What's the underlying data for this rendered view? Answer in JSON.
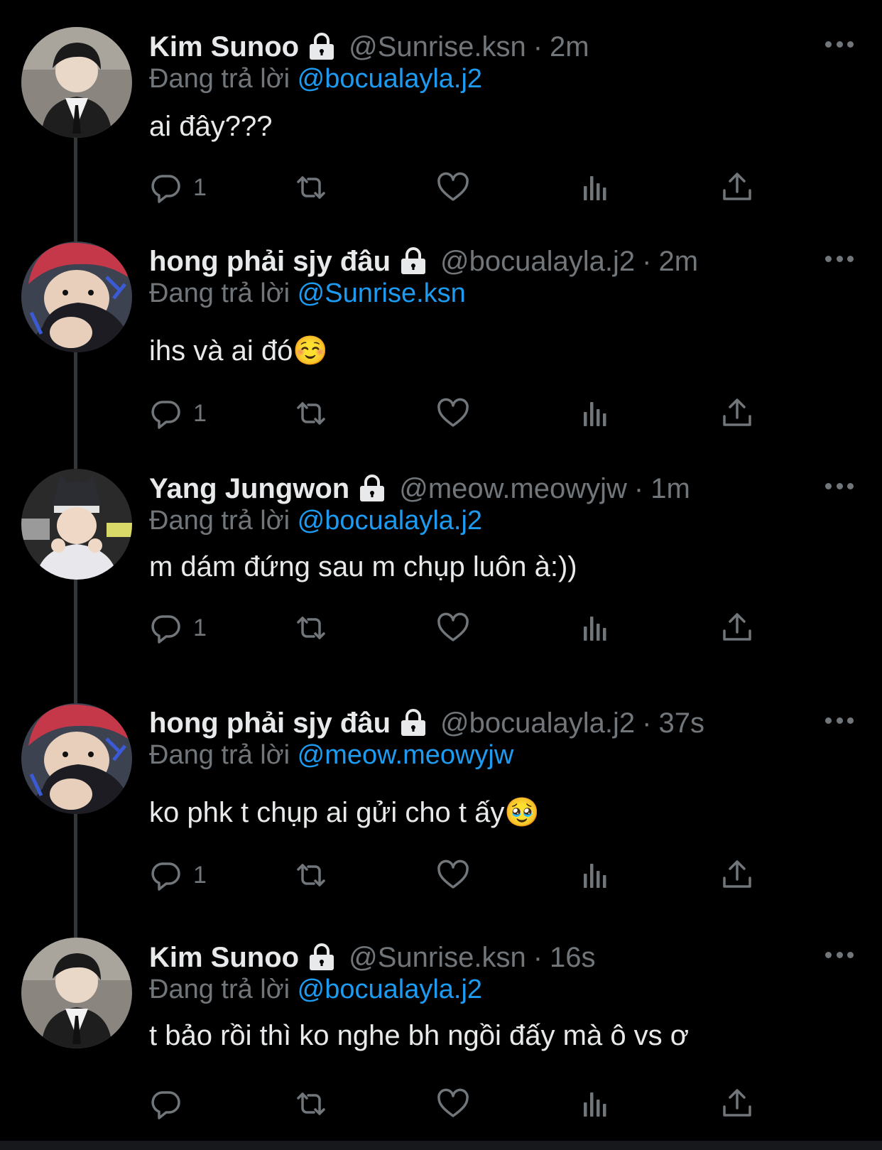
{
  "reply_prefix": "Đang trả lời",
  "colors": {
    "background": "#000000",
    "text": "#e7e9ea",
    "muted": "#71767b",
    "mention": "#1d9bf0"
  },
  "tweets": [
    {
      "name": "Kim Sunoo",
      "handle": "@Sunrise.ksn",
      "separator": "·",
      "time": "2m",
      "replying_to": "@bocualayla.j2",
      "text": "ai đây???",
      "reply_count": "1",
      "avatar": "avatar-kim-sunoo"
    },
    {
      "name": "hong phải sjy đâu",
      "handle": "@bocualayla.j2",
      "separator": "·",
      "time": "2m",
      "replying_to": "@Sunrise.ksn",
      "text": "ihs và ai đó☺️",
      "reply_count": "1",
      "avatar": "avatar-hong-phai-sjy-dau"
    },
    {
      "name": "Yang Jungwon",
      "handle": "@meow.meowyjw",
      "separator": "·",
      "time": "1m",
      "replying_to": "@bocualayla.j2",
      "text": "m dám đứng sau m chụp luôn à:))",
      "reply_count": "1",
      "avatar": "avatar-yang-jungwon"
    },
    {
      "name": "hong phải sjy đâu",
      "handle": "@bocualayla.j2",
      "separator": "·",
      "time": "37s",
      "replying_to": "@meow.meowyjw",
      "text": "ko phk t chụp ai gửi cho t ấy🥹",
      "reply_count": "1",
      "avatar": "avatar-hong-phai-sjy-dau"
    },
    {
      "name": "Kim Sunoo",
      "handle": "@Sunrise.ksn",
      "separator": "·",
      "time": "16s",
      "replying_to": "@bocualayla.j2",
      "text": "t bảo rồi thì ko nghe bh ngồi đấy mà ô vs ơ",
      "reply_count": "",
      "avatar": "avatar-kim-sunoo"
    }
  ],
  "icons": {
    "lock": "lock-icon",
    "more": "more-icon",
    "reply": "reply-icon",
    "retweet": "retweet-icon",
    "like": "heart-icon",
    "views": "views-icon",
    "share": "share-icon"
  }
}
